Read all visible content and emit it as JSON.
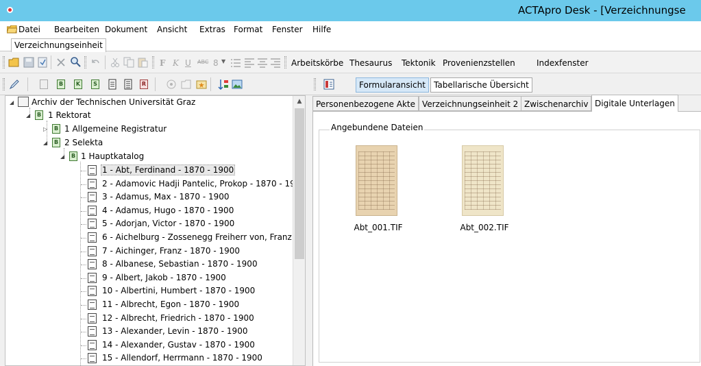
{
  "window": {
    "title": "ACTApro Desk - [Verzeichnungse"
  },
  "menu": [
    "Datei",
    "Bearbeiten",
    "Dokument",
    "Ansicht",
    "Extras",
    "Format",
    "Fenster",
    "Hilfe"
  ],
  "doc_tab": "Verzeichnungseinheit",
  "toolbar1": {
    "font_size": "8",
    "links": [
      "Arbeitskörbe",
      "Thesaurus",
      "Tektonik",
      "Provenienzstellen",
      "Indexfenster"
    ]
  },
  "toolbar2": {
    "view_buttons": [
      "Formularansicht",
      "Tabellarische Übersicht"
    ],
    "active_view": "Formularansicht"
  },
  "tree": {
    "root": "Archiv der Technischen Universität Graz",
    "nodes": [
      {
        "label": "1 Rektorat"
      },
      {
        "label": "1 Allgemeine Registratur"
      },
      {
        "label": "2 Selekta"
      },
      {
        "label": "1 Hauptkatalog"
      }
    ],
    "items": [
      "1 - Abt, Ferdinand - 1870 - 1900",
      "2 - Adamovic Hadji Pantelic, Prokop - 1870 - 19(",
      "3 - Adamus, Max - 1870 - 1900",
      "4 - Adamus, Hugo - 1870 - 1900",
      "5 - Adorjan, Victor - 1870 - 1900",
      "6 - Aichelburg - Zossenegg Freiherr von, Franz -",
      "7 - Aichinger, Franz - 1870 - 1900",
      "8 - Albanese, Sebastian - 1870 - 1900",
      "9 - Albert, Jakob - 1870 - 1900",
      "10 - Albertini, Humbert - 1870 - 1900",
      "11 - Albrecht, Egon - 1870 - 1900",
      "12 - Albrecht, Friedrich - 1870 - 1900",
      "13 - Alexander, Levin - 1870 - 1900",
      "14 - Alexander, Gustav - 1870 - 1900",
      "15 - Allendorf, Herrmann - 1870 - 1900"
    ],
    "selected_index": 0
  },
  "tabs": [
    "Personenbezogene Akte",
    "Verzeichnungseinheit 2",
    "Zwischenarchiv",
    "Digitale Unterlagen"
  ],
  "active_tab": "Digitale Unterlagen",
  "attachments": {
    "group_title": "Angebundene Dateien",
    "files": [
      "Abt_001.TIF",
      "Abt_002.TIF"
    ]
  },
  "colors": {
    "titlebar": "#6bc9eb",
    "selection": "#e8e8e8",
    "active_view": "#d6e8f7"
  }
}
